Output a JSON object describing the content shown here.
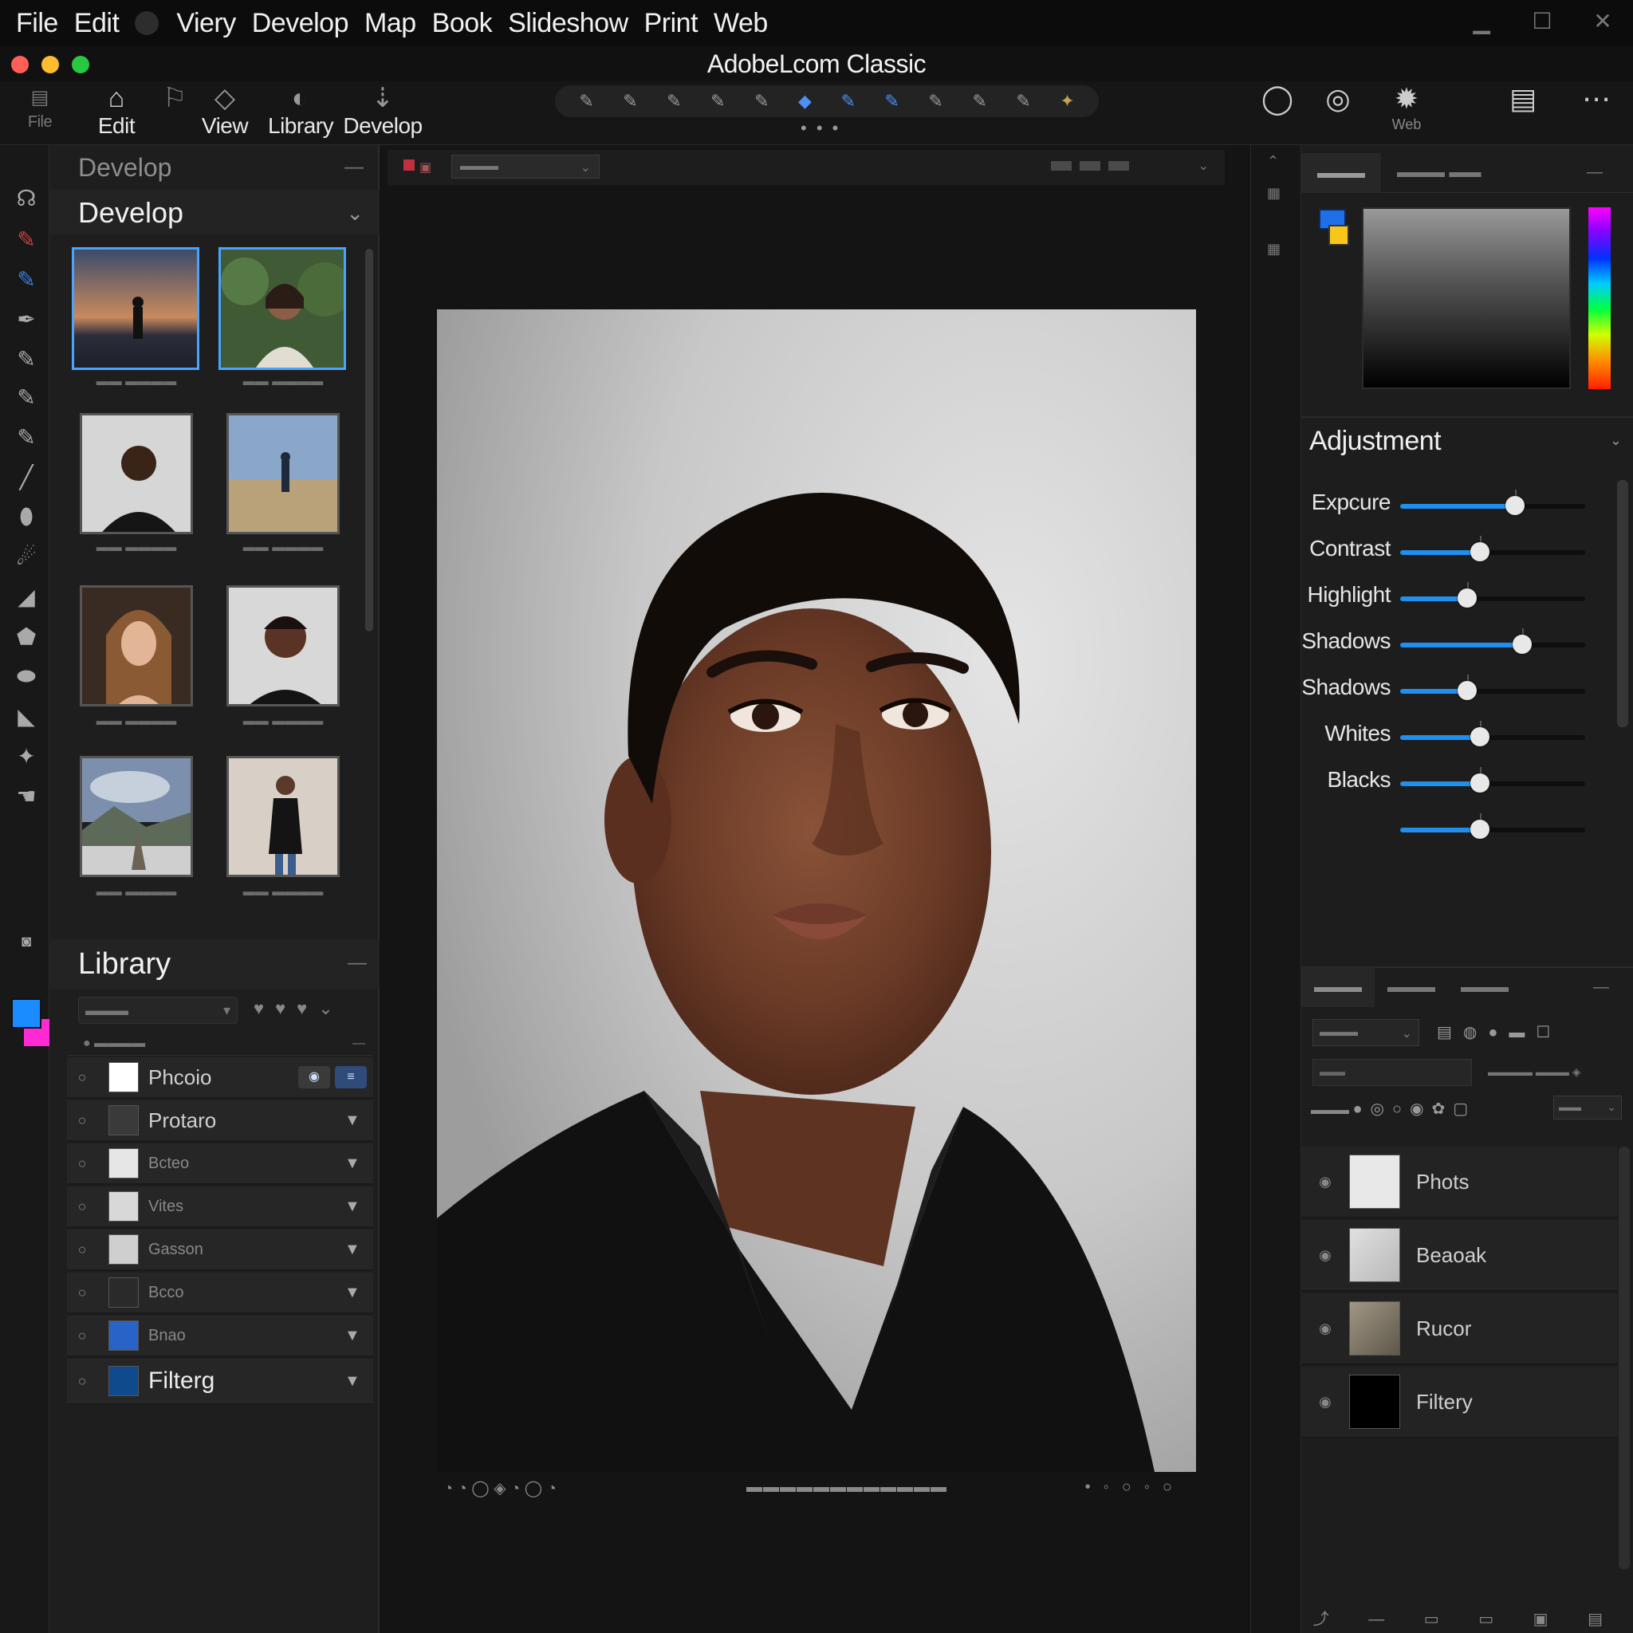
{
  "menu": {
    "items": [
      "File",
      "Edit",
      "Viery",
      "Develop",
      "Map",
      "Book",
      "Slideshow",
      "Print",
      "Web"
    ],
    "window_controls": [
      "minimize",
      "maximize",
      "close"
    ]
  },
  "window": {
    "title": "AdobeLcom Classic",
    "traffic_colors": [
      "#ff5f57",
      "#febc2e",
      "#28c840"
    ]
  },
  "toolbar": {
    "file_label": "File",
    "edit_label": "Edit",
    "view_label": "View",
    "library_label": "Library",
    "develop_label": "Develop",
    "right_labels": [
      "Web"
    ]
  },
  "left_panel": {
    "section_title": "Develop",
    "header_title": "Develop",
    "library_title": "Library",
    "layers": [
      {
        "name": "Phcoio",
        "swatch": "#ffffff",
        "tags": [
          "◉",
          "≡"
        ]
      },
      {
        "name": "Protaro",
        "swatch": "#3a3a3a"
      },
      {
        "name": "Bcteo",
        "swatch": "#e6e6e6"
      },
      {
        "name": "Vites",
        "swatch": "#d8d8d8"
      },
      {
        "name": "Gasson",
        "swatch": "#cfcfcf"
      },
      {
        "name": "Bcco",
        "swatch": "#2a2a2a"
      },
      {
        "name": "Bnao",
        "swatch": "#2a63c8"
      },
      {
        "name": "Filterg",
        "swatch": "#0e4a8c"
      }
    ]
  },
  "adjustment": {
    "title": "Adjustment",
    "sliders": [
      {
        "label": "Expcure",
        "value": 0.62
      },
      {
        "label": "Contrast",
        "value": 0.43
      },
      {
        "label": "Highlight",
        "value": 0.36
      },
      {
        "label": "Shadows",
        "value": 0.66
      },
      {
        "label": "Shadows",
        "value": 0.36
      },
      {
        "label": "Whites",
        "value": 0.43
      },
      {
        "label": "Blacks",
        "value": 0.43
      },
      {
        "label": "",
        "value": 0.43
      }
    ]
  },
  "right_layers": [
    {
      "name": "Phots",
      "thumb": "#e8e8e8"
    },
    {
      "name": "Beaoak",
      "thumb": "#cfcfcf"
    },
    {
      "name": "Rucor",
      "thumb": "#8a8070"
    },
    {
      "name": "Filtery",
      "thumb": "#000000"
    }
  ],
  "colors": {
    "accent": "#1f8ff0",
    "selection": "#4aa3ff",
    "foreground_swatch": "#1a8cff",
    "background_swatch": "#ff2ad4"
  }
}
